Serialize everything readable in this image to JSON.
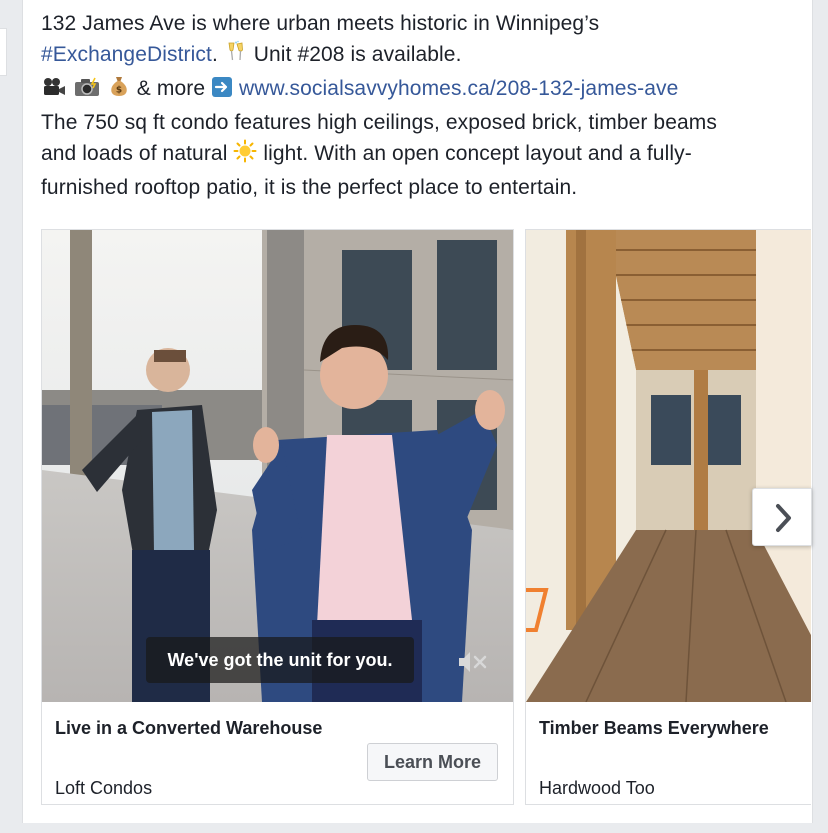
{
  "post": {
    "line1": "132 James Ave is where urban meets historic in Winnipeg’s",
    "hashtag": "#ExchangeDistrict",
    "line2_after": ". ",
    "unit_text": " Unit #208 is available.",
    "more_text": " & more ",
    "link": "www.socialsavvyhomes.ca/208-132-james-ave",
    "para_a": "The 750 sq ft condo features high ceilings, exposed brick, timber beams",
    "para_b_before": "and loads of natural ",
    "para_b_after": " light. With an open concept layout and a fully-",
    "para_c": "furnished rooftop patio, it is the perfect place to entertain."
  },
  "carousel": {
    "slides": [
      {
        "title": "Live in a Converted Warehouse",
        "subtitle": "Loft Condos",
        "button": "Learn More",
        "caption": "We've got the unit for you."
      },
      {
        "title": "Timber Beams Everywhere",
        "subtitle": "Hardwood Too"
      }
    ]
  },
  "icons": {
    "champagne": "clinking-glasses-icon",
    "camera_video": "movie-camera-icon",
    "camera_photo": "camera-flash-icon",
    "money_bag": "money-bag-icon",
    "arrow": "right-arrow-icon",
    "sun": "sun-icon",
    "mute": "mute-icon",
    "next": "chevron-right-icon"
  },
  "colors": {
    "link": "#365899",
    "background": "#e9ebee",
    "card": "#ffffff",
    "border": "#dddfe2"
  }
}
